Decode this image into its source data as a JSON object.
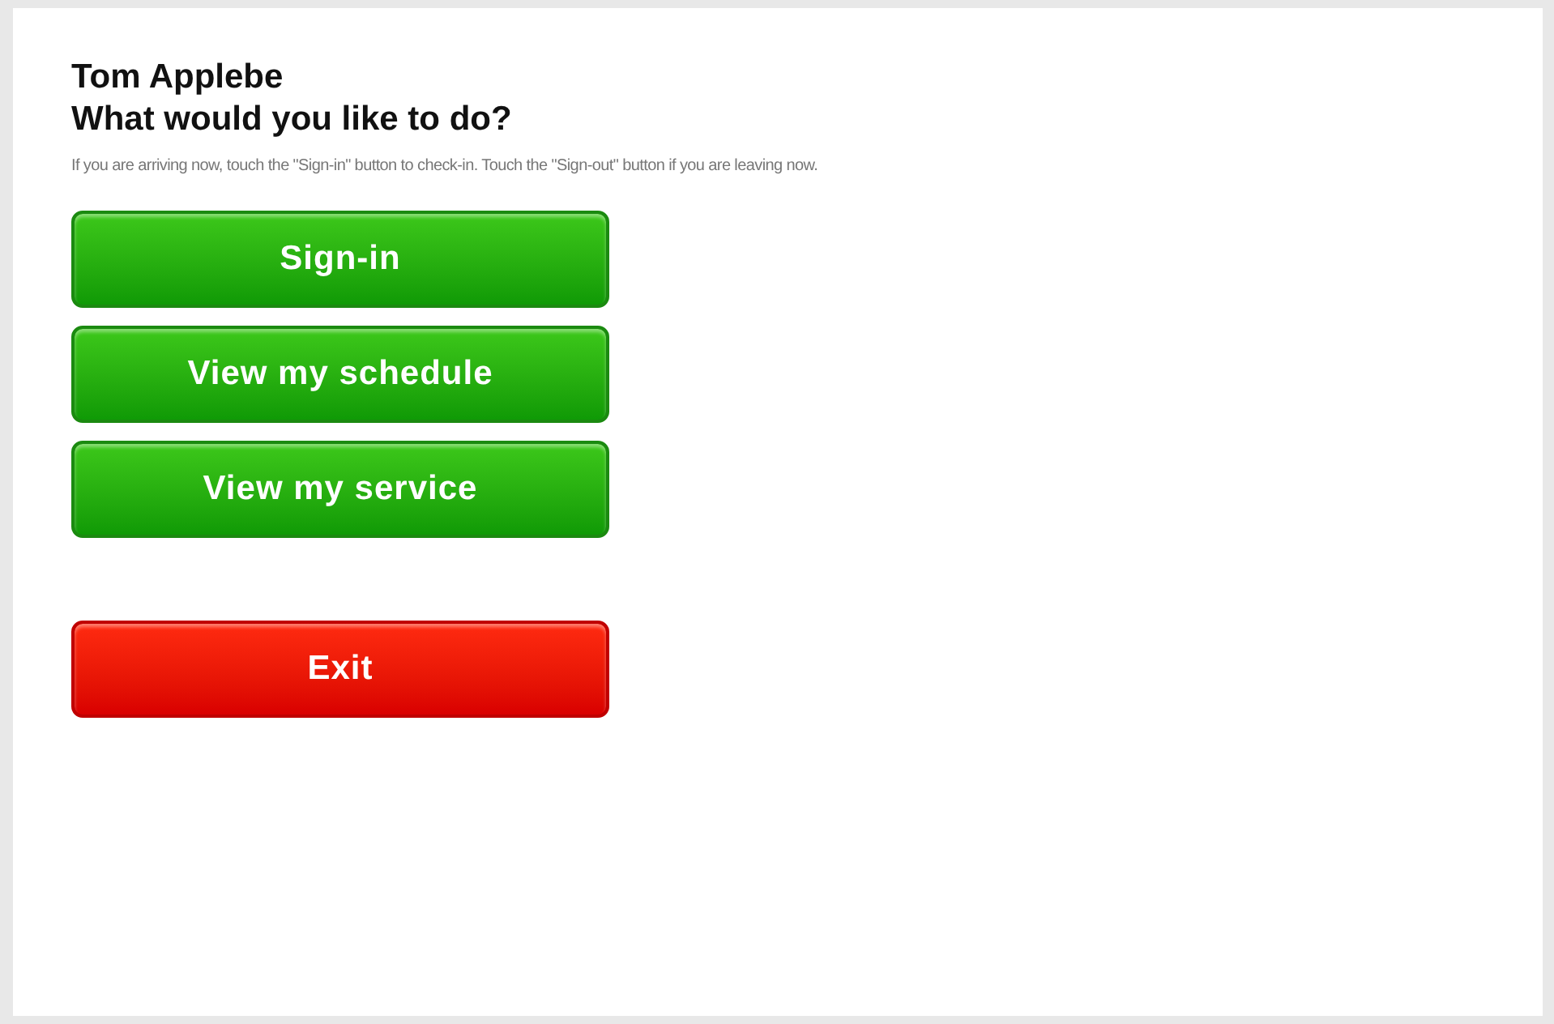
{
  "user_name": "Tom Applebe",
  "heading": "What would you like to do?",
  "instructions": "If you are arriving now, touch the \"Sign-in\" button to check-in. Touch the \"Sign-out\" button if you are leaving now.",
  "buttons": [
    {
      "label": "Sign-in",
      "kind": "action"
    },
    {
      "label": "View my schedule",
      "kind": "action"
    },
    {
      "label": "View my service",
      "kind": "action"
    },
    {
      "label": "Exit",
      "kind": "exit"
    }
  ]
}
